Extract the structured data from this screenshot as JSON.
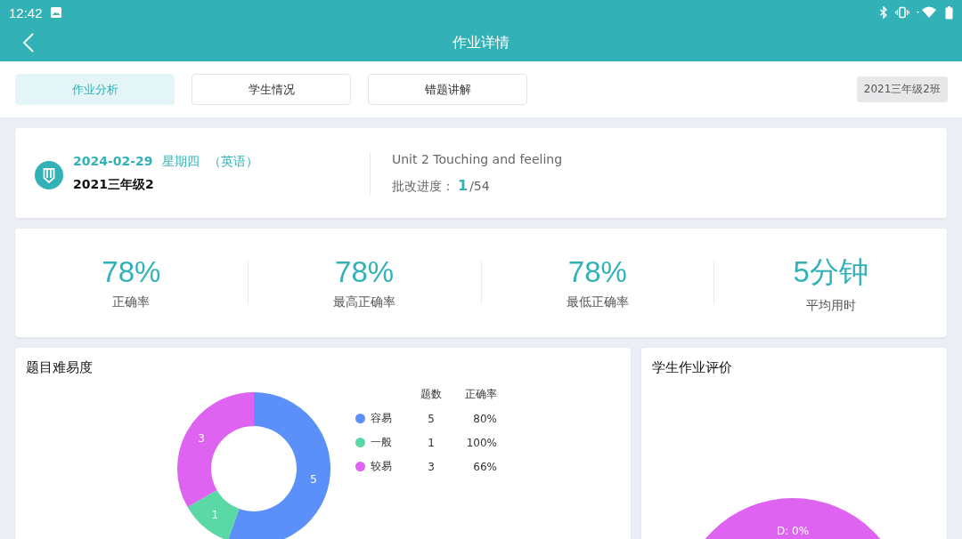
{
  "status_bar": {
    "time": "12:42"
  },
  "header": {
    "title": "作业详情"
  },
  "tabs": [
    {
      "label": "作业分析",
      "selected": true
    },
    {
      "label": "学生情况",
      "selected": false
    },
    {
      "label": "错题讲解",
      "selected": false
    }
  ],
  "class_badge": "2021三年级2班",
  "summary": {
    "date": "2024-02-29",
    "weekday": "星期四",
    "subject": "（英语）",
    "class_name": "2021三年级2",
    "unit": "Unit 2 Touching and feeling",
    "progress_label": "批改进度：",
    "progress_done": "1",
    "progress_total": "/54"
  },
  "stats": [
    {
      "value": "78%",
      "label": "正确率"
    },
    {
      "value": "78%",
      "label": "最高正确率"
    },
    {
      "value": "78%",
      "label": "最低正确率"
    },
    {
      "value": "5分钟",
      "label": "平均用时"
    }
  ],
  "difficulty": {
    "title": "题目难易度",
    "chart_data": {
      "type": "donut",
      "categories": [
        "容易",
        "一般",
        "较易"
      ],
      "series": [
        {
          "name": "题数",
          "values": [
            5,
            1,
            3
          ]
        }
      ],
      "colors": [
        "#5b8ff9",
        "#5ad8a6",
        "#dd63f0"
      ],
      "data_labels": true
    },
    "rate_header": "正确率",
    "counts": [
      "5",
      "1",
      "3"
    ],
    "rates": [
      "80%",
      "100%",
      "66%"
    ]
  },
  "evaluation": {
    "title": "学生作业评价",
    "slice_label": "D: 0%"
  }
}
